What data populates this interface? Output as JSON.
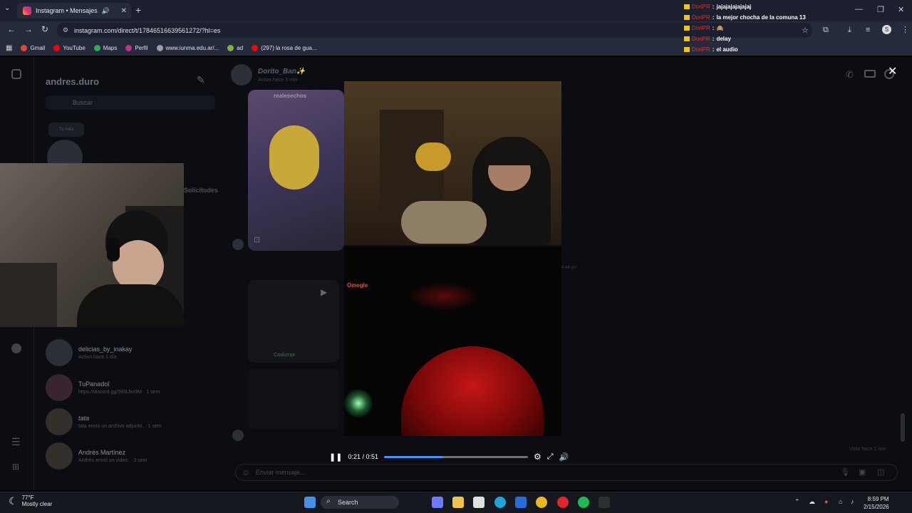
{
  "browser": {
    "tab_title": "Instagram • Mensajes",
    "url": "instagram.com/direct/t/17846516639561272/?hl=es",
    "bookmarks": [
      {
        "label": "Gmail",
        "color": "#ea4335"
      },
      {
        "label": "YouTube",
        "color": "#ff0000"
      },
      {
        "label": "Maps",
        "color": "#34a853"
      },
      {
        "label": "Perfil",
        "color": "#c13584"
      },
      {
        "label": "www.iunma.edu.ar/...",
        "color": "#9aa0a6"
      },
      {
        "label": "ad",
        "color": "#7cb342"
      },
      {
        "label": "(297) la rosa de gua...",
        "color": "#ff0000"
      }
    ]
  },
  "stream_chat": [
    {
      "user": "DoriPR",
      "message": "jajajajajajajaj"
    },
    {
      "user": "DoriPR",
      "message": "la mejor chocha de la comuna 13"
    },
    {
      "user": "DoriPR",
      "message": "🙈"
    },
    {
      "user": "DoriPR",
      "message": "delay"
    },
    {
      "user": "DoriPR",
      "message": "el audio"
    }
  ],
  "instagram": {
    "username": "andres.duro",
    "search_placeholder": "Buscar",
    "note": "Tu nota",
    "requests": "Solicitudes",
    "threads": [
      {
        "name": "delicias_by_inakay",
        "sub": "Activo hace 1 día"
      },
      {
        "name": "TuPanadol",
        "sub": "https://discord.gg/593tJkx9M · 1 sem"
      },
      {
        "name": "tata",
        "sub": "tata envió un archivo adjunto. · 1 sem"
      },
      {
        "name": "Andrés Martínez",
        "sub": "Andrés envió un video. · 3 sem"
      }
    ],
    "conversation": {
      "name": "Dorito_Ban✨",
      "status": "Activo hace 3 min",
      "reel_author": "realesechos",
      "shared_by": "Caalumpr",
      "time_label": "4:44 pm",
      "seen": "Visto hace 1 min",
      "composer_placeholder": "Enviar mensaje..."
    }
  },
  "video": {
    "time": "0:21 / 0:51",
    "progress_fraction": 0.41,
    "overlay_tag": "Omegle"
  },
  "taskbar": {
    "temperature": "77°F",
    "condition": "Mostly clear",
    "search_label": "Search",
    "time": "8:59 PM",
    "date": "2/15/2026"
  }
}
